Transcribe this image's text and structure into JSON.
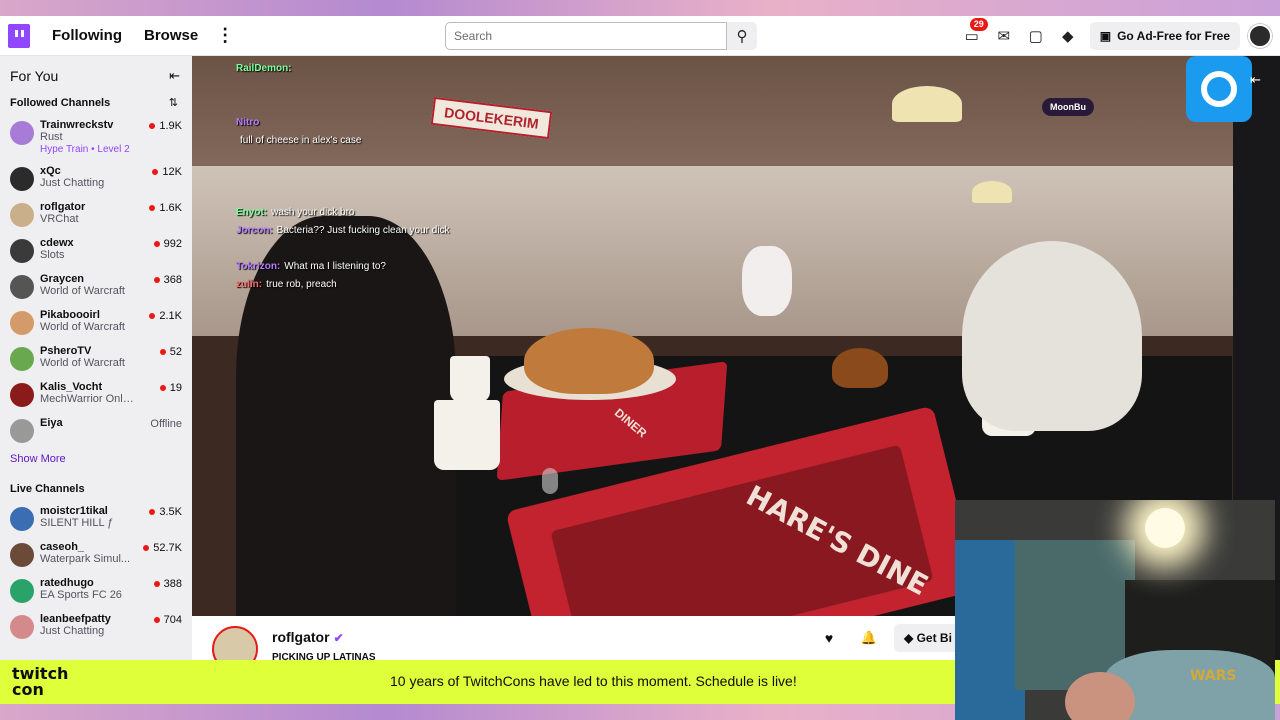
{
  "topnav": {
    "following": "Following",
    "browse": "Browse",
    "search_placeholder": "Search",
    "notif_count": "29",
    "adfree_label": "Go Ad-Free for Free"
  },
  "sidebar": {
    "for_you": "For You",
    "followed_title": "Followed Channels",
    "followed": [
      {
        "name": "Trainwreckstv",
        "game": "Rust",
        "extra": "Hype Train • Level 2",
        "viewers": "1.9K",
        "color": "#a87bd6"
      },
      {
        "name": "xQc",
        "game": "Just Chatting",
        "viewers": "12K",
        "color": "#2b2b2b"
      },
      {
        "name": "roflgator",
        "game": "VRChat",
        "viewers": "1.6K",
        "color": "#c9b08a"
      },
      {
        "name": "cdewx",
        "game": "Slots",
        "viewers": "992",
        "color": "#3a3a3a"
      },
      {
        "name": "Graycen",
        "game": "World of Warcraft",
        "viewers": "368",
        "color": "#555"
      },
      {
        "name": "Pikaboooirl",
        "game": "World of Warcraft",
        "viewers": "2.1K",
        "color": "#d49a6a"
      },
      {
        "name": "PsheroTV",
        "game": "World of Warcraft",
        "viewers": "52",
        "color": "#6aa84f"
      },
      {
        "name": "Kalis_Vocht",
        "game": "MechWarrior Online",
        "viewers": "19",
        "color": "#8b1a1a"
      },
      {
        "name": "Eiya",
        "game": "",
        "viewers": "Offline",
        "color": "#999"
      }
    ],
    "show_more": "Show More",
    "live_title": "Live Channels",
    "live": [
      {
        "name": "moistcr1tikal",
        "game": "SILENT HILL ƒ",
        "viewers": "3.5K",
        "color": "#3b6db3"
      },
      {
        "name": "caseoh_",
        "game": "Waterpark Simul...",
        "viewers": "52.7K",
        "color": "#6b4a3a"
      },
      {
        "name": "ratedhugo",
        "game": "EA Sports FC 26",
        "viewers": "388",
        "color": "#2aa36a"
      },
      {
        "name": "leanbeefpatty",
        "game": "Just Chatting",
        "viewers": "704",
        "color": "#d48a8a"
      }
    ]
  },
  "player": {
    "sign_text": "DOOLEKERIM",
    "tray_text": "HARE'S DINE",
    "tray_small": "DINER",
    "overlay_tag": "MoonBu",
    "chat": [
      {
        "user": "RailDemon:",
        "msg": "",
        "color": "#7dff9c"
      },
      {
        "user": "",
        "msg": "",
        "color": "#ff6b6b"
      },
      {
        "user": "",
        "msg": "",
        "color": "#ff6b6b"
      },
      {
        "user": "Nitro",
        "msg": "",
        "color": "#b57bff"
      },
      {
        "user": "",
        "msg": "full of cheese in alex's case",
        "color": "#ffffff"
      },
      {
        "user": "",
        "msg": "",
        "color": "#b57bff"
      },
      {
        "user": "",
        "msg": "",
        "color": "#ff6b6b"
      },
      {
        "user": "",
        "msg": "",
        "color": "#7dd3ff"
      },
      {
        "user": "Enyot:",
        "msg": "wash your dick bro",
        "color": "#7dff9c"
      },
      {
        "user": "Jorcon:",
        "msg": "Bacteria?? Just fucking clean your dick",
        "color": "#b57bff"
      },
      {
        "user": "",
        "msg": "",
        "color": "#ff6b6b"
      },
      {
        "user": "Tokrizon:",
        "msg": "What ma I listening to?",
        "color": "#b57bff"
      },
      {
        "user": "zulin:",
        "msg": "true rob, preach",
        "color": "#ff6b6b"
      }
    ]
  },
  "channel": {
    "name": "roflgator",
    "title": "PICKING UP LATINAS",
    "get_bits": "Get Bi"
  },
  "banner": {
    "logo_line1": "twitch",
    "logo_line2": "con",
    "text": "10 years of TwitchCons have led to this moment. Schedule is live!"
  },
  "webcam": {
    "wars_text": "WARS"
  }
}
